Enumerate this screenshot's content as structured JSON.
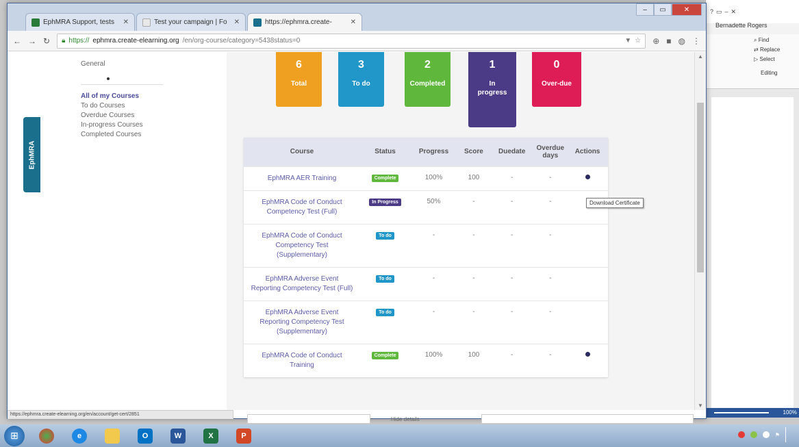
{
  "browser": {
    "tabs": [
      {
        "label": "EphMRA Support, tests",
        "favicon_color": "#2a7a3a"
      },
      {
        "label": "Test your campaign | Fo",
        "favicon_color": "#e8e8e8"
      },
      {
        "label": "https://ephmra.create-",
        "favicon_color": "#1a6f8d"
      }
    ],
    "url_secure": "https://",
    "url_host": "ephmra.create-elearning.org",
    "url_path": "/en/org-course/category=5438status=0",
    "status_url": "https://ephmra.create-elearning.org/en/account/get-cert/2851"
  },
  "word": {
    "user": "Bernadette Rogers",
    "find": "Find",
    "replace": "Replace",
    "select": "Select",
    "editing": "Editing",
    "zoom": "100%"
  },
  "sidebar": {
    "vertical_tab": "EphMRA",
    "general": "General",
    "items": [
      {
        "label": "All of my Courses",
        "active": true
      },
      {
        "label": "To do Courses",
        "active": false
      },
      {
        "label": "Overdue Courses",
        "active": false
      },
      {
        "label": "In-progress Courses",
        "active": false
      },
      {
        "label": "Completed Courses",
        "active": false
      }
    ]
  },
  "stats": {
    "total": {
      "value": "6",
      "label": "Total"
    },
    "todo": {
      "value": "3",
      "label": "To do"
    },
    "completed": {
      "value": "2",
      "label": "Completed"
    },
    "inprogress": {
      "value": "1",
      "label": "In progress"
    },
    "overdue": {
      "value": "0",
      "label": "Over-due"
    }
  },
  "table": {
    "headers": [
      "Course",
      "Status",
      "Progress",
      "Score",
      "Duedate",
      "Overdue days",
      "Actions"
    ],
    "rows": [
      {
        "course": "EphMRA AER Training",
        "status": "Complete",
        "status_class": "complete",
        "progress": "100%",
        "score": "100",
        "duedate": "-",
        "overdue": "-",
        "action": true
      },
      {
        "course": "EphMRA Code of Conduct Competency Test (Full)",
        "status": "In Progress",
        "status_class": "inprogress",
        "progress": "50%",
        "score": "-",
        "duedate": "-",
        "overdue": "-",
        "action": false
      },
      {
        "course": "EphMRA Code of Conduct Competency Test (Supplementary)",
        "status": "To do",
        "status_class": "todo",
        "progress": "-",
        "score": "-",
        "duedate": "-",
        "overdue": "-",
        "action": false
      },
      {
        "course": "EphMRA Adverse Event Reporting Competency Test (Full)",
        "status": "To do",
        "status_class": "todo",
        "progress": "-",
        "score": "-",
        "duedate": "-",
        "overdue": "-",
        "action": false
      },
      {
        "course": "EphMRA Adverse Event Reporting Competency Test (Supplementary)",
        "status": "To do",
        "status_class": "todo",
        "progress": "-",
        "score": "-",
        "duedate": "-",
        "overdue": "-",
        "action": false
      },
      {
        "course": "EphMRA Code of Conduct Training",
        "status": "Complete",
        "status_class": "complete",
        "progress": "100%",
        "score": "100",
        "duedate": "-",
        "overdue": "-",
        "action": true
      }
    ]
  },
  "tooltip": "Download Certificate",
  "hide_details": "Hide details"
}
